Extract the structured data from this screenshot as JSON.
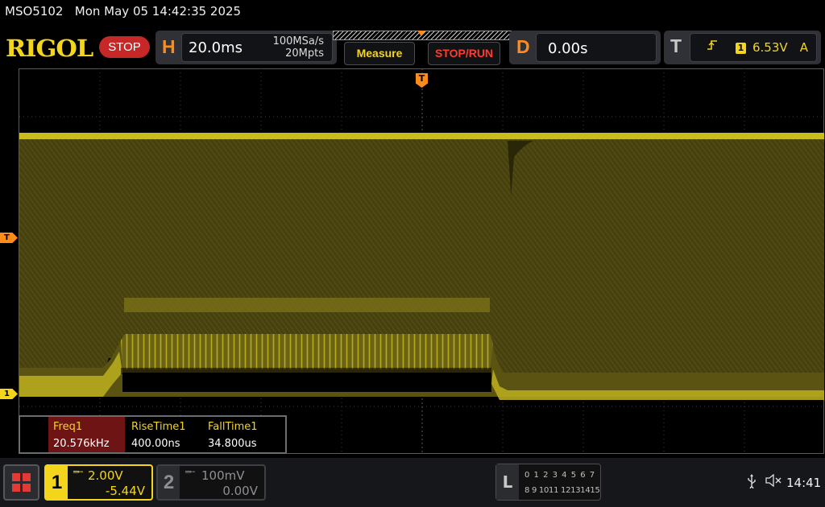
{
  "status": {
    "model": "MSO5102",
    "datetime": "Mon May 05 14:42:35 2025"
  },
  "header": {
    "logo": "RIGOL",
    "run_state": "STOP",
    "horizontal": {
      "letter": "H",
      "timebase": "20.0ms",
      "sample_rate": "100MSa/s",
      "memory_depth": "20Mpts"
    },
    "buttons": {
      "measure": "Measure",
      "stop_run": "STOP/RUN"
    },
    "delay": {
      "letter": "D",
      "value": "0.00s"
    },
    "trigger": {
      "letter": "T",
      "edge_icon": "rising-edge-icon",
      "source": "1",
      "level": "6.53V",
      "mode": "A"
    }
  },
  "markers": {
    "trigger_top": "T",
    "trigger_level": "T",
    "ch1_ground": "1"
  },
  "measurements": [
    {
      "name": "Freq1",
      "value": "20.576kHz"
    },
    {
      "name": "RiseTime1",
      "value": "400.00ns"
    },
    {
      "name": "FallTime1",
      "value": "34.800us"
    }
  ],
  "channels": {
    "ch1": {
      "number": "1",
      "coupling_icon": "dc-coupling-icon",
      "scale": "2.00V",
      "offset": "-5.44V",
      "color": "#f3d51c"
    },
    "ch2": {
      "number": "2",
      "coupling_icon": "dc-coupling-icon",
      "scale": "100mV",
      "offset": "0.00V",
      "color": "#8d8f94"
    }
  },
  "logic": {
    "letter": "L",
    "row1": "0 1 2 3  4 5 6 7",
    "row2": "8 9 1011 12131415"
  },
  "system": {
    "clock": "14:41",
    "usb_icon": "usb-icon",
    "mute_icon": "speaker-muted-icon"
  },
  "colors": {
    "accent_orange": "#ff8c1a",
    "trace_yellow": "#f3d51c",
    "stop_red": "#c62828"
  }
}
